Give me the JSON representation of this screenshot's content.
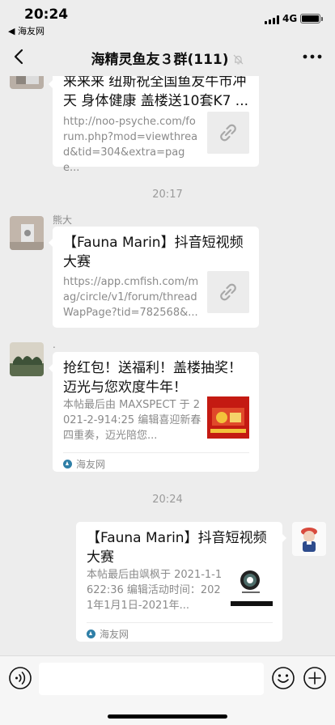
{
  "status_bar": {
    "time": "20:24",
    "back_app": "◀ 海友网",
    "network": "4G"
  },
  "header": {
    "title": "海精灵鱼友３群(111)"
  },
  "messages": [
    {
      "side": "left",
      "title": "来来来 纽斯祝全国鱼友牛市冲天 身体健康 盖楼送10套K7 ...",
      "description": "http://noo-psyche.com/forum.php?mod=viewthread&tid=304&extra=page..."
    },
    {
      "time": "20:17"
    },
    {
      "side": "left",
      "sender": "熊大",
      "title": "【Fauna Marin】抖音短视频大赛",
      "description": "https://app.cmfish.com/mag/circle/v1/forum/threadWapPage?tid=782568&..."
    },
    {
      "side": "left",
      "sender": ".",
      "title": "抢红包！送福利！盖楼抽奖！迈光与您欢度牛年！",
      "description": "本帖最后由 MAXSPECT 于 2021-2-914:25 编辑喜迎新春四重奏，迈光陪您...",
      "source": "海友网"
    },
    {
      "time": "20:24"
    },
    {
      "side": "right",
      "title": "【Fauna Marin】抖音短视频大赛",
      "description": "本帖最后由飒枫于 2021-1-1622:36 编辑活动时间：2021年1月1日-2021年...",
      "source": "海友网"
    }
  ],
  "icons": {
    "back": "chevron-left-icon",
    "mute": "bell-off-icon",
    "more": "more-icon",
    "link": "link-icon",
    "voice": "voice-icon",
    "emoji": "emoji-icon",
    "add": "add-icon"
  },
  "colors": {
    "chat_background": "#ededed",
    "bubble": "#ffffff",
    "meta_text": "#8a8a8a"
  }
}
